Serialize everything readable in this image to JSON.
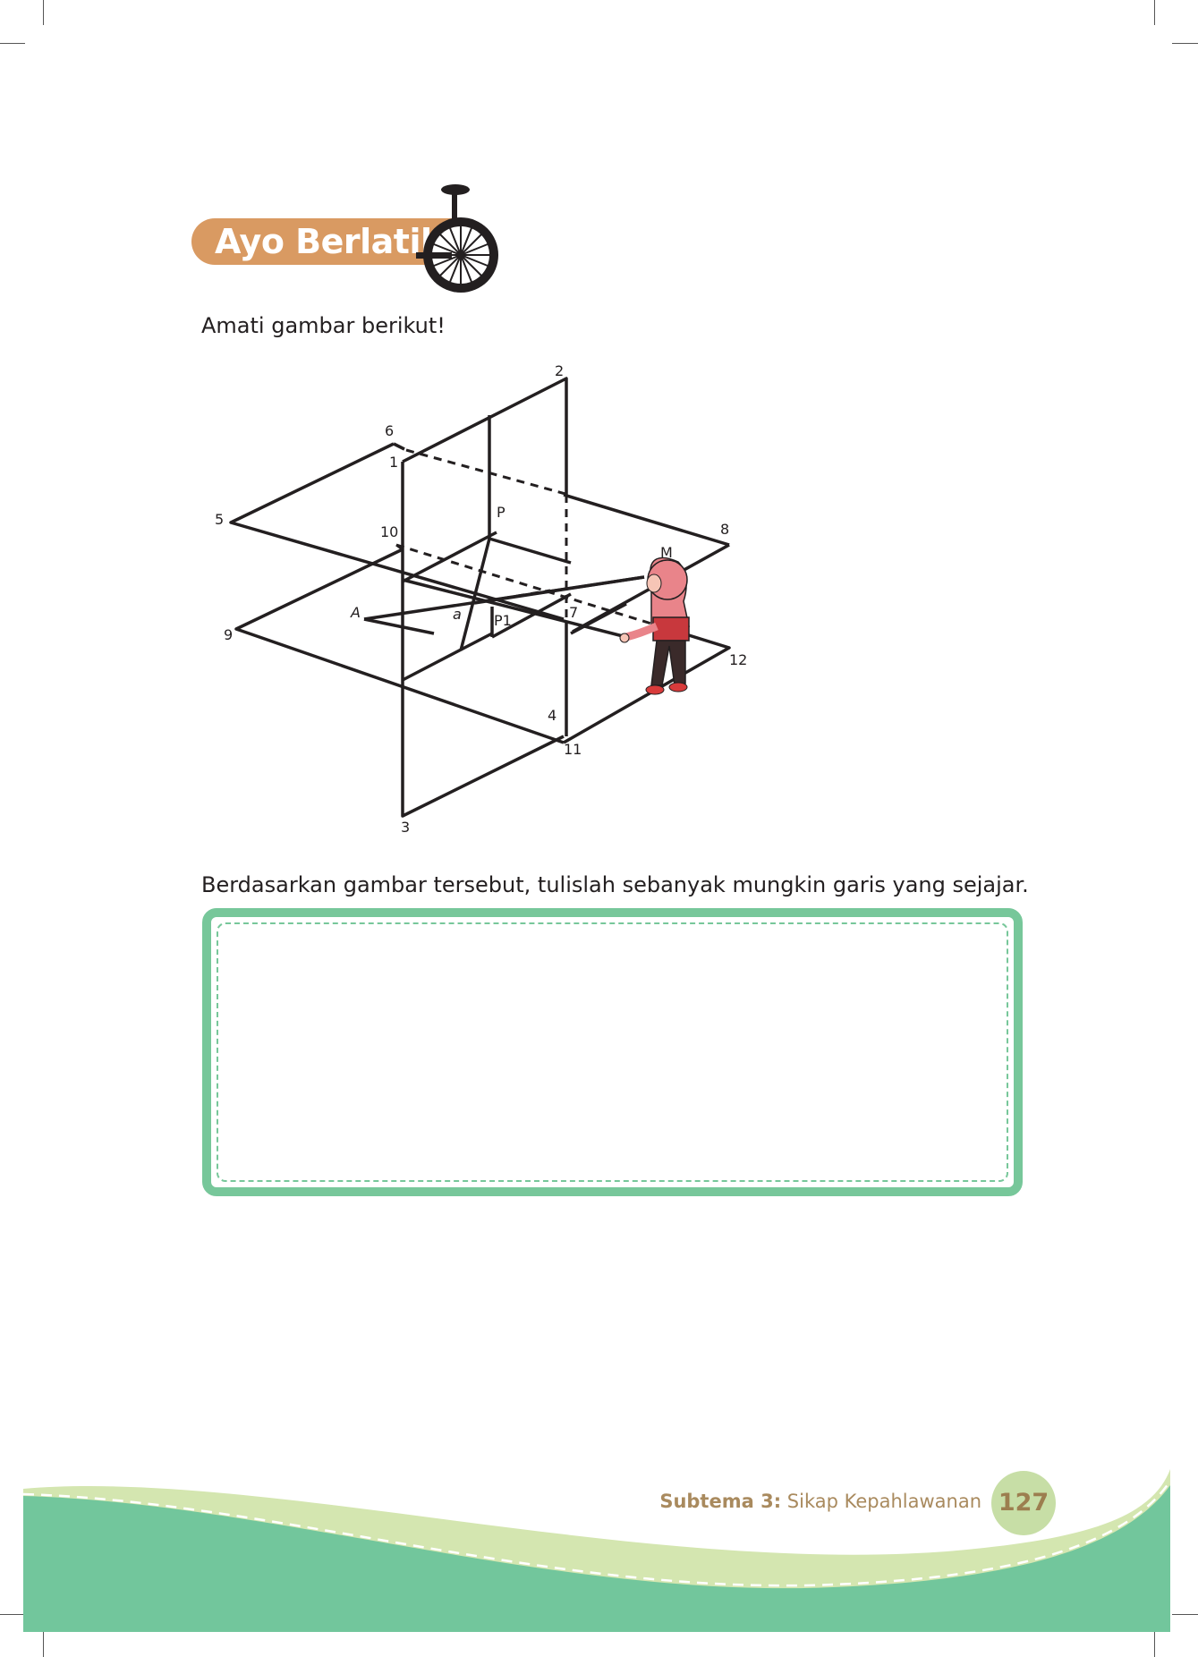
{
  "section": {
    "title": "Ayo Berlatih",
    "icon": "unicycle-icon"
  },
  "instruction": "Amati gambar berikut!",
  "figure": {
    "labels": {
      "n1": "1",
      "n2": "2",
      "n3": "3",
      "n4": "4",
      "n5": "5",
      "n6": "6",
      "n7": "7",
      "n8": "8",
      "n9": "9",
      "n10": "10",
      "n11": "11",
      "n12": "12",
      "P": "P",
      "P1": "P1",
      "A": "A",
      "a": "a",
      "M": "M"
    },
    "illustration": "girl-figure"
  },
  "question": "Berdasarkan gambar tersebut, tulislah sebanyak mungkin garis yang sejajar.",
  "answer_box": {
    "value": ""
  },
  "footer": {
    "subtema_label": "Subtema 3:",
    "subtema_title": "Sikap Kepahlawanan",
    "page_number": "127"
  },
  "colors": {
    "banner": "#d99a62",
    "box_border": "#77c79a",
    "footer_green": "#72c69c",
    "footer_light": "#d4e6b0",
    "footer_text": "#a98a5e"
  }
}
